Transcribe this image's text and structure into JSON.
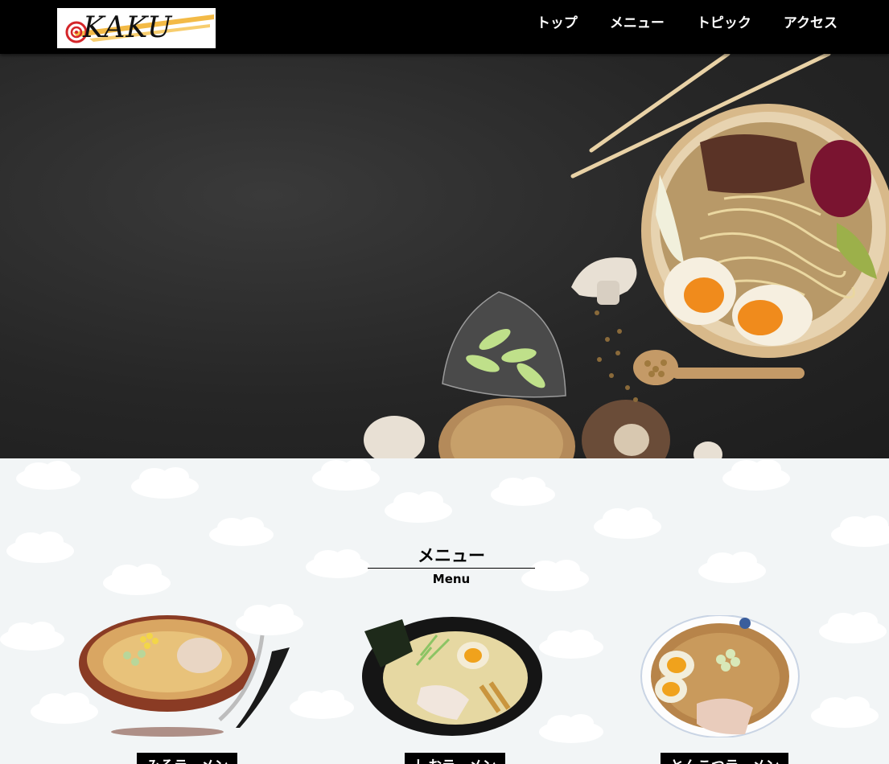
{
  "header": {
    "logo_text": "KAKU",
    "nav": [
      {
        "label": "トップ"
      },
      {
        "label": "メニュー"
      },
      {
        "label": "トピック"
      },
      {
        "label": "アクセス"
      }
    ]
  },
  "hero": {
    "image": "ramen-bowl-with-chopsticks-mushrooms-spices"
  },
  "menu": {
    "title": "メニュー",
    "subtitle": "Menu",
    "items": [
      {
        "name": "みそラーメン",
        "image": "miso-ramen-bowl"
      },
      {
        "name": "しおラーメン",
        "image": "shio-ramen-bowl"
      },
      {
        "name": "とんこつラーメン",
        "image": "tonkotsu-ramen-bowl"
      }
    ]
  },
  "colors": {
    "header_bg": "#000000",
    "hero_bg": "#262626",
    "section_bg": "#f2f5f6",
    "label_bg": "#000000"
  }
}
